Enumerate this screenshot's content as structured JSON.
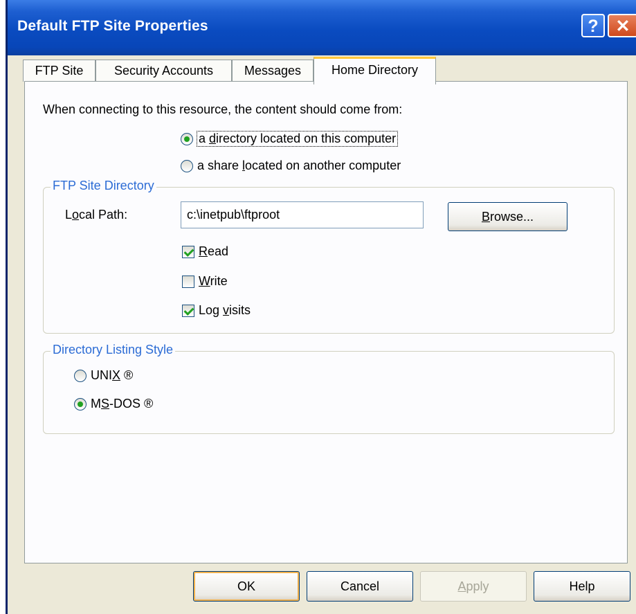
{
  "window": {
    "title": "Default FTP Site Properties",
    "help_glyph": "?",
    "close_glyph": "✕"
  },
  "tabs": [
    {
      "label": "FTP Site",
      "active": false
    },
    {
      "label": "Security Accounts",
      "active": false
    },
    {
      "label": "Messages",
      "active": false
    },
    {
      "label": "Home Directory",
      "active": true
    }
  ],
  "content_source": {
    "prompt": "When connecting to this resource, the content should come from:",
    "options": [
      {
        "pre": "a ",
        "key": "d",
        "post": "irectory located on this computer",
        "selected": true
      },
      {
        "pre": "a share ",
        "key": "l",
        "post": "ocated on another computer",
        "selected": false
      }
    ]
  },
  "ftp_site_directory": {
    "legend": "FTP Site Directory",
    "local_path_label_pre": "L",
    "local_path_label_key": "o",
    "local_path_label_post": "cal Path:",
    "local_path_value": "c:\\inetpub\\ftproot",
    "browse_key": "B",
    "browse_rest": "rowse...",
    "permissions": [
      {
        "key": "R",
        "post": "ead",
        "pre": "",
        "checked": true
      },
      {
        "key": "W",
        "post": "rite",
        "pre": "",
        "checked": false
      },
      {
        "key": "v",
        "post": "isits",
        "pre": "Log ",
        "checked": true
      }
    ]
  },
  "listing_style": {
    "legend": "Directory Listing Style",
    "options": [
      {
        "pre": "UNI",
        "key": "X",
        "post": " ®",
        "selected": false
      },
      {
        "pre": "M",
        "key": "S",
        "post": "-DOS ®",
        "selected": true
      }
    ]
  },
  "footer": {
    "ok": "OK",
    "cancel": "Cancel",
    "apply_key": "A",
    "apply_rest": "pply",
    "help": "Help"
  },
  "colors": {
    "title_bar": "#0a4bc0",
    "group_legend": "#2c6cd5",
    "active_tab_highlight": "#ffc83c",
    "radio_check_mark": "#21a121"
  }
}
